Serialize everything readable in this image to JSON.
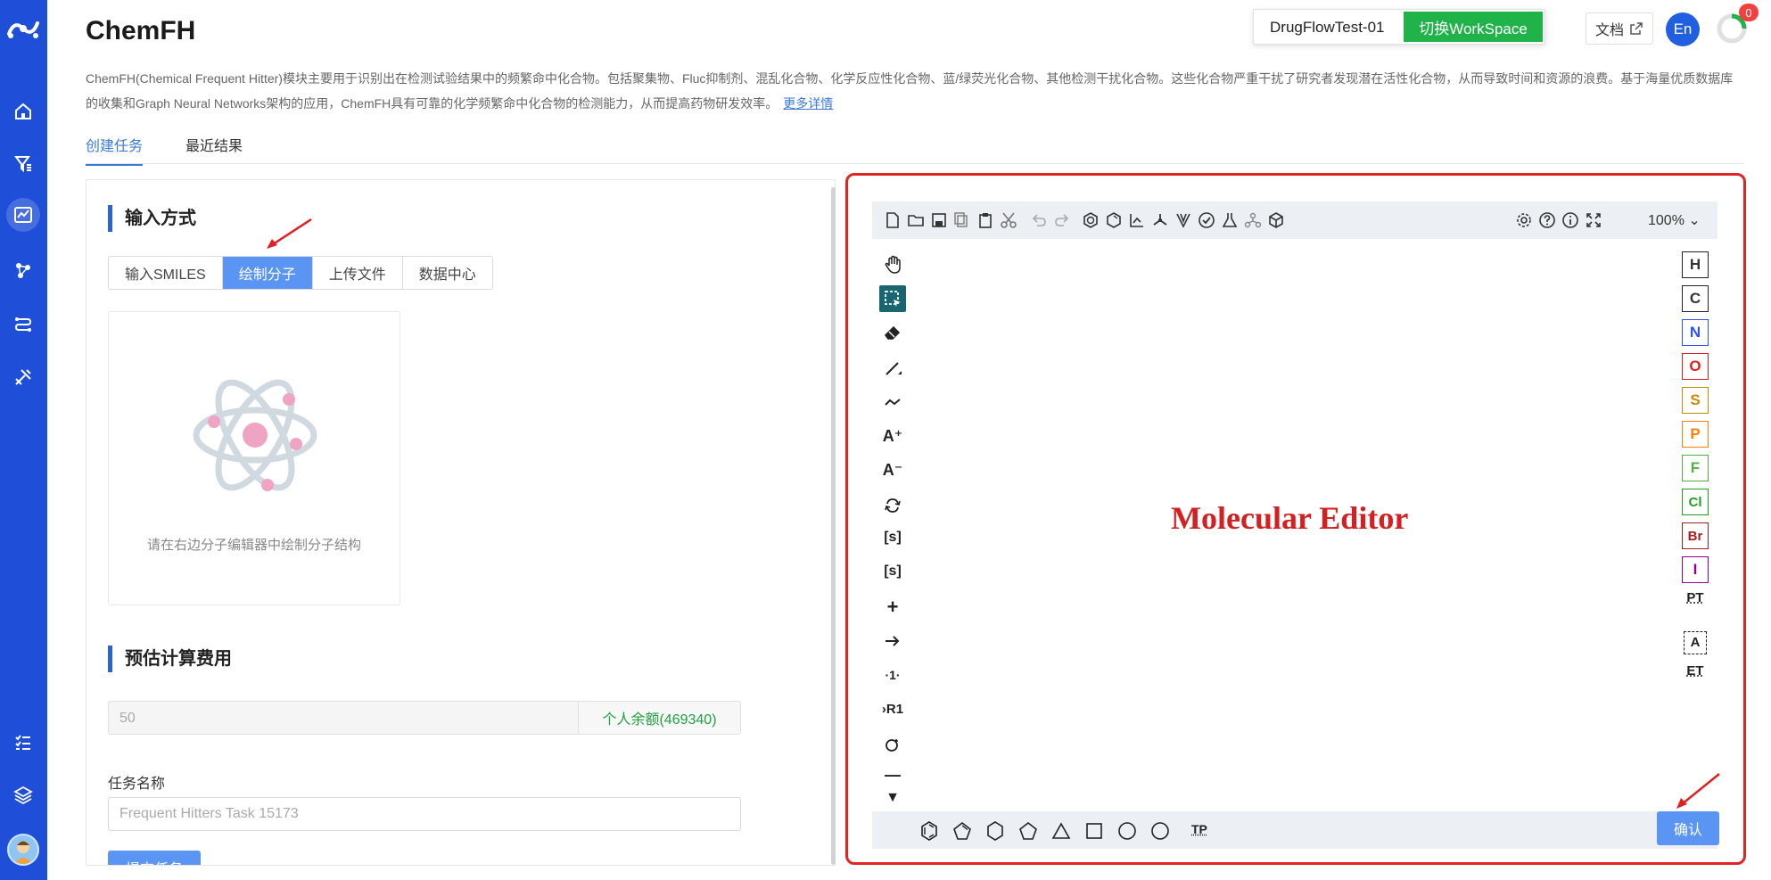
{
  "app": {
    "title": "ChemFH"
  },
  "header": {
    "workspace_name": "DrugFlowTest-01",
    "workspace_switch": "切换WorkSpace",
    "doc_label": "文档",
    "lang": "En",
    "notification_count": "0"
  },
  "description": {
    "text": "ChemFH(Chemical Frequent Hitter)模块主要用于识别出在检测试验结果中的频繁命中化合物。包括聚集物、Fluc抑制剂、混乱化合物、化学反应性化合物、蓝/绿荧光化合物、其他检测干扰化合物。这些化合物严重干扰了研究者发现潜在活性化合物，从而导致时间和资源的浪费。基于海量优质数据库的收集和Graph Neural Networks架构的应用，ChemFH具有可靠的化学频繁命中化合物的检测能力，从而提高药物研发效率。",
    "more_link": "更多详情"
  },
  "tabs": [
    {
      "label": "创建任务"
    },
    {
      "label": "最近结果"
    }
  ],
  "input_section": {
    "title": "输入方式",
    "options": [
      "输入SMILES",
      "绘制分子",
      "上传文件",
      "数据中心"
    ],
    "selected": "绘制分子",
    "hint": "请在右边分子编辑器中绘制分子结构"
  },
  "cost_section": {
    "title": "预估计算费用",
    "value": "50",
    "balance": "个人余额(469340)"
  },
  "task": {
    "label": "任务名称",
    "placeholder": "Frequent Hitters Task 15173",
    "submit": "提交任务"
  },
  "editor": {
    "label": "Molecular Editor",
    "zoom": "100%",
    "confirm": "确认",
    "elements": [
      "H",
      "C",
      "N",
      "O",
      "S",
      "P",
      "F",
      "Cl",
      "Br",
      "I"
    ],
    "element_colors": [
      "#222222",
      "#222222",
      "#3050f8",
      "#e02020",
      "#c88a00",
      "#ff8000",
      "#50b040",
      "#20a020",
      "#a02020",
      "#940094"
    ],
    "extra_buttons": [
      "PT",
      "A",
      "ET"
    ],
    "left_tools": [
      "hand-icon",
      "select-icon",
      "eraser-icon",
      "bond-icon",
      "chain-icon",
      "charge-plus-icon",
      "charge-minus-icon",
      "rotate-icon",
      "sgroup-icon",
      "sgroup-plus-icon",
      "plus-icon",
      "arrow-icon",
      "rgroup-icon",
      "rlabel-icon",
      "cycle-icon",
      "minus-icon",
      "more-icon"
    ],
    "bottom_tools": [
      "benzene-icon",
      "cyclopentadiene-icon",
      "cyclohexane-icon",
      "cyclopentane-icon",
      "cyclopropane-icon",
      "cyclobutane-icon",
      "cycloheptane-icon",
      "cyclooctane-icon",
      "template-icon"
    ],
    "template_label": "TP"
  },
  "sidebar": {
    "items": [
      "home-icon",
      "filter-icon",
      "chart-icon",
      "molecule-icon",
      "flow-icon",
      "tools-icon",
      "tasks-icon",
      "layers-icon"
    ]
  },
  "colors": {
    "accent": "#1f4fd8",
    "primary_button": "#5b95f3",
    "switch_green": "#20b34a",
    "highlight_red": "#e02424"
  }
}
